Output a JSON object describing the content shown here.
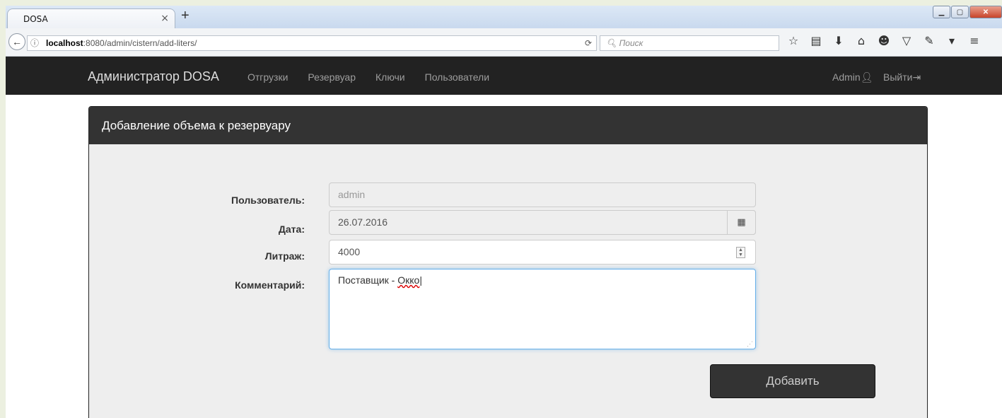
{
  "browser": {
    "tab_title": "DOSA",
    "tab_close": "×",
    "new_tab": "+",
    "url_prefix": "localhost",
    "url_rest": ":8080/admin/cistern/add-liters/",
    "search_placeholder": "Поиск",
    "info_icon": "ⓘ",
    "reload_icon": "C",
    "back_icon": "←"
  },
  "app": {
    "brand": "Администратор DOSA",
    "nav": [
      {
        "label": "Отгрузки"
      },
      {
        "label": "Резервуар"
      },
      {
        "label": "Ключи"
      },
      {
        "label": "Пользователи"
      }
    ],
    "user_label": "Admin",
    "logout_label": "Выйти"
  },
  "panel": {
    "title": "Добавление объема к резервуару"
  },
  "form": {
    "user_label": "Пользователь:",
    "user_value": "admin",
    "date_label": "Дата:",
    "date_value": "26.07.2016",
    "liters_label": "Литраж:",
    "liters_value": "4000",
    "comment_label": "Комментарий:",
    "comment_prefix": "Поставщик - ",
    "comment_misspelled": "Окко",
    "submit_label": "Добавить"
  }
}
